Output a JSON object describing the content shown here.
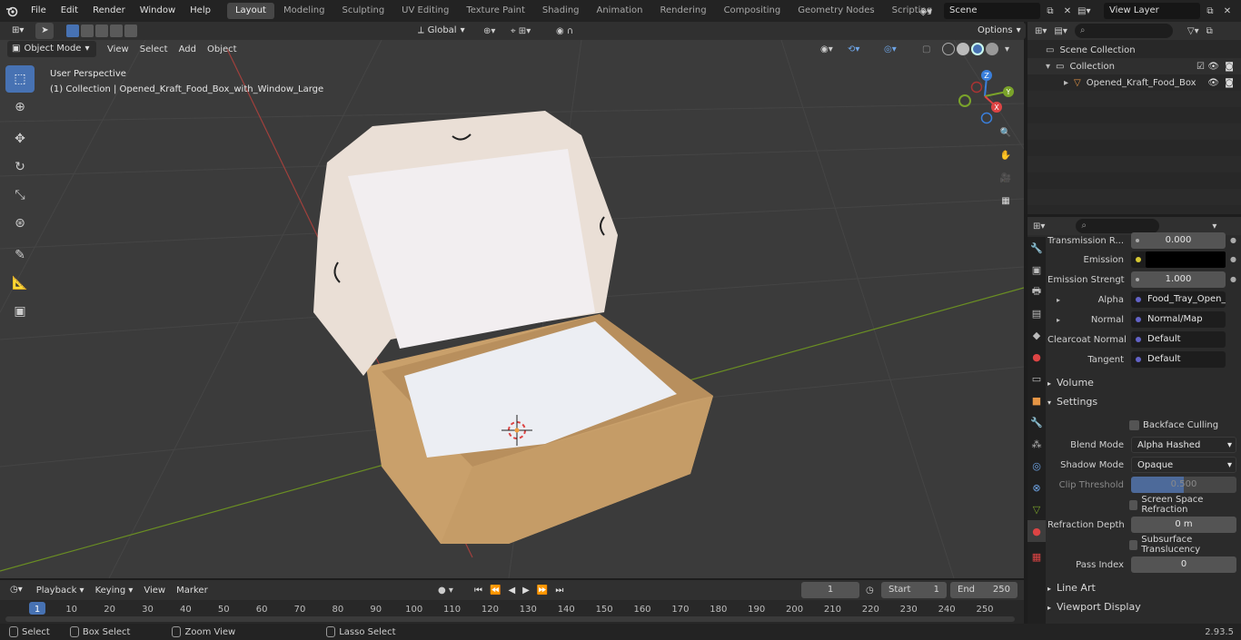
{
  "topbar": {
    "menus": [
      "File",
      "Edit",
      "Render",
      "Window",
      "Help"
    ],
    "workspaces": [
      "Layout",
      "Modeling",
      "Sculpting",
      "UV Editing",
      "Texture Paint",
      "Shading",
      "Animation",
      "Rendering",
      "Compositing",
      "Geometry Nodes",
      "Scripting"
    ],
    "active_workspace": "Layout",
    "scene": "Scene",
    "view_layer": "View Layer"
  },
  "viewport_header": {
    "mode": "Object Mode",
    "menus": [
      "View",
      "Select",
      "Add",
      "Object"
    ],
    "orientation": "Global",
    "options": "Options"
  },
  "viewport": {
    "perspective": "User Perspective",
    "collection_info": "(1) Collection | Opened_Kraft_Food_Box_with_Window_Large",
    "gizmo_axes": [
      "X",
      "Y",
      "Z"
    ]
  },
  "outliner": {
    "root": "Scene Collection",
    "collection": "Collection",
    "object": "Opened_Kraft_Food_Box"
  },
  "properties": {
    "rows": [
      {
        "label": "Transmission R...",
        "value": "0.000",
        "kind": "number"
      },
      {
        "label": "Emission",
        "value": "",
        "kind": "color",
        "dot": "#d6c832"
      },
      {
        "label": "Emission Strengt",
        "value": "1.000",
        "kind": "number"
      },
      {
        "label": "Alpha",
        "value": "Food_Tray_Open_L...",
        "kind": "socket",
        "dot": "#6363c7"
      },
      {
        "label": "Normal",
        "value": "Normal/Map",
        "kind": "socket",
        "dot": "#6363c7"
      },
      {
        "label": "Clearcoat Normal",
        "value": "Default",
        "kind": "socket",
        "dot": "#6363c7"
      },
      {
        "label": "Tangent",
        "value": "Default",
        "kind": "socket",
        "dot": "#6363c7"
      }
    ],
    "volume": "Volume",
    "settings": "Settings",
    "backface_culling": "Backface Culling",
    "blend_mode_label": "Blend Mode",
    "blend_mode": "Alpha Hashed",
    "shadow_mode_label": "Shadow Mode",
    "shadow_mode": "Opaque",
    "clip_threshold_label": "Clip Threshold",
    "clip_threshold": "0.500",
    "screen_space_refraction": "Screen Space Refraction",
    "refraction_depth_label": "Refraction Depth",
    "refraction_depth": "0 m",
    "subsurface_translucency": "Subsurface Translucency",
    "pass_index_label": "Pass Index",
    "pass_index": "0",
    "line_art": "Line Art",
    "viewport_display": "Viewport Display"
  },
  "timeline": {
    "menus": [
      "Playback",
      "Keying",
      "View",
      "Marker"
    ],
    "current_frame": "1",
    "start_label": "Start",
    "start": "1",
    "end_label": "End",
    "end": "250",
    "ticks": [
      "1",
      "10",
      "20",
      "30",
      "40",
      "50",
      "60",
      "70",
      "80",
      "90",
      "100",
      "110",
      "120",
      "130",
      "140",
      "150",
      "160",
      "170",
      "180",
      "190",
      "200",
      "210",
      "220",
      "230",
      "240",
      "250"
    ]
  },
  "statusbar": {
    "select": "Select",
    "box_select": "Box Select",
    "zoom_view": "Zoom View",
    "lasso_select": "Lasso Select",
    "version": "2.93.5"
  },
  "colors": {
    "accent": "#4772b3",
    "viewport_bg": "#3b3b3b",
    "box_kraft": "#c9a06b",
    "box_lid_interior": "#e8e3df"
  }
}
